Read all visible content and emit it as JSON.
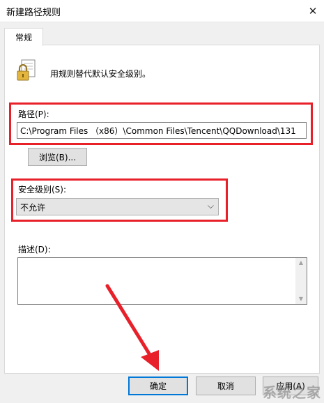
{
  "window": {
    "title": "新建路径规则",
    "close_glyph": "✕"
  },
  "tabs": [
    {
      "label": "常规",
      "selected": true
    }
  ],
  "rule": {
    "description": "用规则替代默认安全级别。",
    "path_label": "路径(P):",
    "path_value": "C:\\Program Files （x86）\\Common Files\\Tencent\\QQDownload\\131",
    "browse_label": "浏览(B)...",
    "security_level_label": "安全级别(S):",
    "security_level_value": "不允许",
    "comment_label": "描述(D):",
    "comment_value": ""
  },
  "buttons": {
    "ok": "确定",
    "cancel": "取消",
    "apply": "应用(A)"
  },
  "watermark": "系统之家",
  "colors": {
    "annotation": "#e8202a",
    "focus": "#0078d7"
  }
}
